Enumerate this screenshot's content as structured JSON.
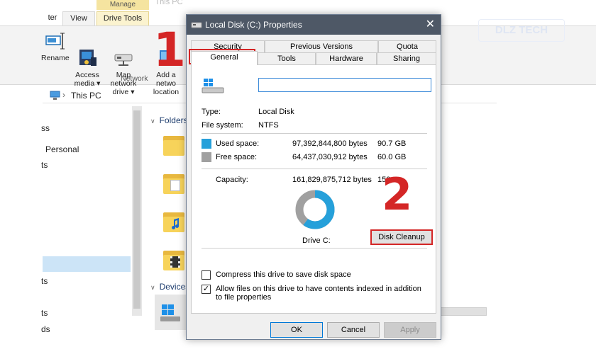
{
  "explorer": {
    "ribbon_tabs": {
      "file_partial": "ter",
      "view": "View",
      "manage": "Manage",
      "drive_tools": "Drive Tools",
      "window_title_partial": "This PC"
    },
    "ribbon_buttons": {
      "rename": "Rename",
      "access_media": "Access\nmedia ▾",
      "map_network_drive": "Map network\ndrive ▾",
      "add_network_location": "Add a netwo\nlocation"
    },
    "group_network": "Network",
    "address": "This PC",
    "nav_items": [
      "ss",
      "Personal",
      "ts",
      "ts",
      "ts",
      "ds"
    ],
    "section_folders": "Folders",
    "section_devices": "Devices"
  },
  "dialog": {
    "title": "Local Disk (C:) Properties",
    "close_glyph": "✕",
    "tabs_top": [
      "Security",
      "Previous Versions",
      "Quota"
    ],
    "tabs_bottom": [
      "General",
      "Tools",
      "Hardware",
      "Sharing"
    ],
    "name_value": "",
    "type_label": "Type:",
    "type_value": "Local Disk",
    "fs_label": "File system:",
    "fs_value": "NTFS",
    "used": {
      "label": "Used space:",
      "bytes": "97,392,844,800 bytes",
      "size": "90.7 GB",
      "color": "#26a0da"
    },
    "free": {
      "label": "Free space:",
      "bytes": "64,437,030,912 bytes",
      "size": "60.0 GB",
      "color": "#a0a0a0"
    },
    "capacity": {
      "label": "Capacity:",
      "bytes": "161,829,875,712 bytes",
      "size_partial": "150"
    },
    "drive_label": "Drive C:",
    "used_fraction": 0.602,
    "disk_cleanup": "Disk Cleanup",
    "compress": {
      "label": "Compress this drive to save disk space",
      "checked": false
    },
    "index": {
      "label": "Allow files on this drive to have contents indexed in addition to file properties",
      "checked": true
    },
    "ok": "OK",
    "cancel": "Cancel",
    "apply": "Apply"
  },
  "annotations": {
    "step1": "1",
    "step2": "2",
    "highlight_color": "#d42626"
  },
  "watermark": "DLZ TECH"
}
